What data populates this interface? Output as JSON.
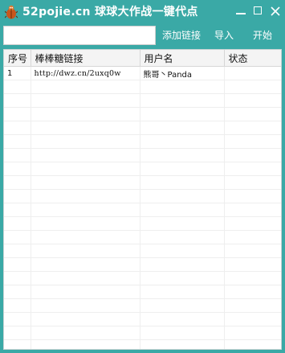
{
  "window": {
    "title": "52pojie.cn 球球大作战一键代点",
    "icon": "bug-icon"
  },
  "toolbar": {
    "link_input_value": "",
    "add_link_label": "添加链接",
    "import_label": "导入",
    "start_label": "开始"
  },
  "table": {
    "columns": [
      "序号",
      "棒棒糖链接",
      "用户名",
      "状态"
    ],
    "rows": [
      [
        "1",
        "http://dwz.cn/2uxq0w",
        "熊哥丶Panda",
        ""
      ]
    ],
    "empty_row_count": 20
  }
}
